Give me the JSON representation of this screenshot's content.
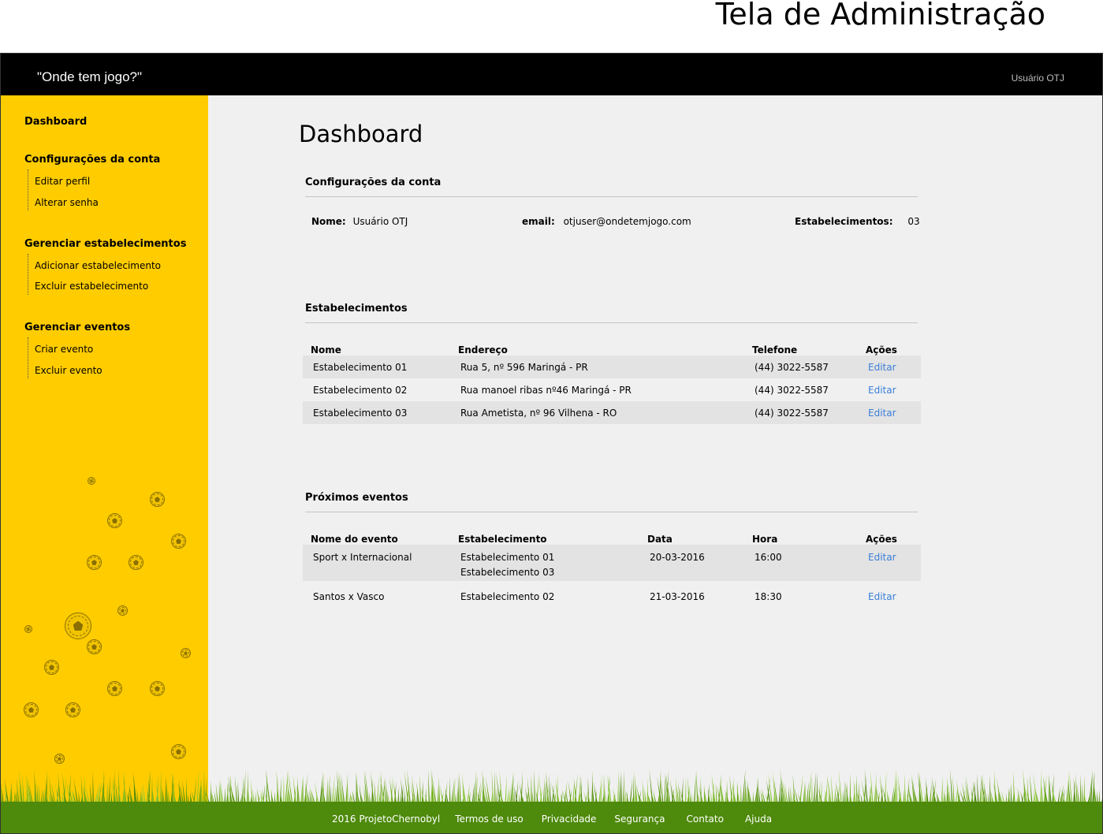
{
  "page_heading": "Tela de Administração",
  "header": {
    "brand": "\"Onde tem jogo?\"",
    "user": "Usuário OTJ"
  },
  "sidebar": {
    "dashboard": "Dashboard",
    "groups": [
      {
        "title": "Configurações da conta",
        "items": [
          "Editar perfil",
          "Alterar senha"
        ]
      },
      {
        "title": "Gerenciar estabelecimentos",
        "items": [
          "Adicionar estabelecimento",
          "Excluir estabelecimento"
        ]
      },
      {
        "title": "Gerenciar eventos",
        "items": [
          "Criar evento",
          "Excluir evento"
        ]
      }
    ]
  },
  "main": {
    "title": "Dashboard",
    "account": {
      "title": "Configurações da conta",
      "name_label": "Nome:",
      "name_value": "Usuário OTJ",
      "email_label": "email:",
      "email_value": "otjuser@ondetemjogo.com",
      "estab_label": "Estabelecimentos:",
      "estab_value": "03"
    },
    "establishments": {
      "title": "Estabelecimentos",
      "headers": [
        "Nome",
        "Endereço",
        "Telefone",
        "Ações"
      ],
      "rows": [
        {
          "nome": "Estabelecimento 01",
          "endereco": "Rua 5, nº 596 Maringá - PR",
          "telefone": "(44) 3022-5587",
          "acao": "Editar"
        },
        {
          "nome": "Estabelecimento 02",
          "endereco": "Rua manoel ribas nº46 Maringá - PR",
          "telefone": "(44) 3022-5587",
          "acao": "Editar"
        },
        {
          "nome": "Estabelecimento 03",
          "endereco": "Rua Ametista, nº 96 Vilhena - RO",
          "telefone": "(44) 3022-5587",
          "acao": "Editar"
        }
      ]
    },
    "events": {
      "title": "Próximos eventos",
      "headers": [
        "Nome do evento",
        "Estabelecimento",
        "Data",
        "Hora",
        "Ações"
      ],
      "rows": [
        {
          "nome": "Sport x Internacional",
          "estab1": "Estabelecimento 01",
          "estab2": "Estabelecimento 03",
          "data": "20-03-2016",
          "hora": "16:00",
          "acao": "Editar"
        },
        {
          "nome": "Santos x Vasco",
          "estab1": "Estabelecimento 02",
          "estab2": "",
          "data": "21-03-2016",
          "hora": "18:30",
          "acao": "Editar"
        }
      ]
    }
  },
  "footer": {
    "links": [
      "2016 ProjetoChernobyl",
      "Termos de uso",
      "Privacidade",
      "Segurança",
      "Contato",
      "Ajuda"
    ]
  },
  "colors": {
    "topbar": "#000000",
    "sidebar": "#ffcc00",
    "content_bg": "#f0f0f0",
    "link": "#3a7fd9",
    "footer": "#4e8a0b"
  },
  "icons": {
    "sidebar_decoration": "soccer-ball-icon",
    "footer_decoration": "grass"
  }
}
